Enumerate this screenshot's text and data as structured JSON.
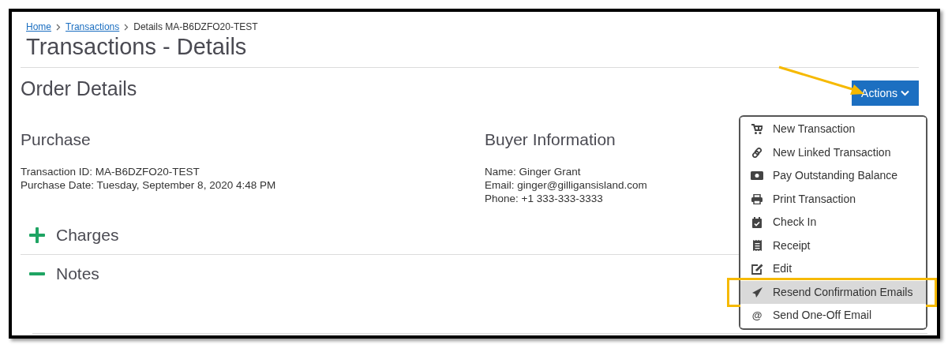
{
  "breadcrumb": [
    {
      "label": "Home",
      "link": true
    },
    {
      "label": "Transactions",
      "link": true
    },
    {
      "label": "Details MA-B6DZFO20-TEST",
      "link": false
    }
  ],
  "title": "Transactions - Details",
  "section_title": "Order Details",
  "actions_button": {
    "label": "Actions",
    "expanded": true
  },
  "purchase": {
    "heading": "Purchase",
    "lines": [
      "Transaction ID: MA-B6DZFO20-TEST",
      "Purchase Date: Tuesday, September 8, 2020 4:48 PM"
    ]
  },
  "buyer": {
    "heading": "Buyer Information",
    "lines": [
      "Name: Ginger Grant",
      "Email: ginger@gilligansisland.com",
      "Phone: +1 333-333-3333"
    ]
  },
  "sections": [
    {
      "label": "Charges",
      "expanded": false
    },
    {
      "label": "Notes",
      "expanded": true
    }
  ],
  "menu": [
    {
      "label": "New Transaction",
      "kind": "cart",
      "highlighted": false
    },
    {
      "label": "New Linked Transaction",
      "kind": "link",
      "highlighted": false
    },
    {
      "label": "Pay Outstanding Balance",
      "kind": "money",
      "highlighted": false
    },
    {
      "label": "Print Transaction",
      "kind": "print",
      "highlighted": false
    },
    {
      "label": "Check In",
      "kind": "calendar",
      "highlighted": false
    },
    {
      "label": "Receipt",
      "kind": "receipt",
      "highlighted": false
    },
    {
      "label": "Edit",
      "kind": "edit",
      "highlighted": false
    },
    {
      "label": "Resend Confirmation Emails",
      "kind": "send",
      "highlighted": true
    },
    {
      "label": "Send One-Off Email",
      "kind": "at",
      "glyph": "@",
      "highlighted": false
    }
  ]
}
